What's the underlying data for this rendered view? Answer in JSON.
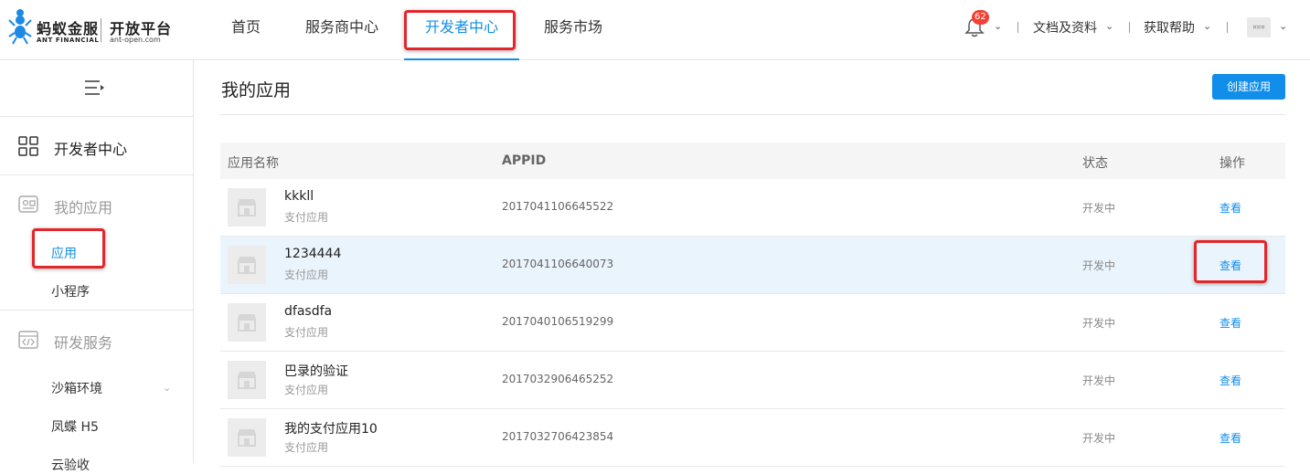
{
  "header": {
    "logo": {
      "brand_cn": "蚂蚁金服",
      "brand_en": "ANT FINANCIAL",
      "platform_cn": "开放平台",
      "platform_en": "ant-open.com"
    },
    "nav": [
      {
        "label": "首页"
      },
      {
        "label": "服务商中心"
      },
      {
        "label": "开发者中心",
        "active": true
      },
      {
        "label": "服务市场"
      }
    ],
    "notification_count": "62",
    "docs_label": "文档及资料",
    "help_label": "获取帮助",
    "avatar_text": "¤¤¤"
  },
  "sidebar": {
    "dev_center": "开发者中心",
    "my_apps": "我的应用",
    "sub_apps": "应用",
    "sub_miniprogram": "小程序",
    "rd_services": "研发服务",
    "sandbox": "沙箱环境",
    "fengdie": "凤蝶 H5",
    "cloud_acceptance": "云验收"
  },
  "main": {
    "title": "我的应用",
    "create_button": "创建应用",
    "columns": {
      "name": "应用名称",
      "appid": "APPID",
      "status": "状态",
      "action": "操作"
    },
    "rows": [
      {
        "name": "kkkll",
        "type": "支付应用",
        "appid": "2017041106645522",
        "status": "开发中",
        "action": "查看"
      },
      {
        "name": "1234444",
        "type": "支付应用",
        "appid": "2017041106640073",
        "status": "开发中",
        "action": "查看"
      },
      {
        "name": "dfasdfa",
        "type": "支付应用",
        "appid": "2017040106519299",
        "status": "开发中",
        "action": "查看"
      },
      {
        "name": "巴录的验证",
        "type": "支付应用",
        "appid": "2017032906465252",
        "status": "开发中",
        "action": "查看"
      },
      {
        "name": "我的支付应用10",
        "type": "支付应用",
        "appid": "2017032706423854",
        "status": "开发中",
        "action": "查看"
      }
    ]
  },
  "colors": {
    "accent": "#108ee9",
    "highlight": "#e4262b",
    "badge": "#f04134",
    "row_hover": "#eaf4fc"
  },
  "icons": [
    "ant-logo-icon",
    "bell-icon",
    "chevron-down-icon",
    "menu-toggle-icon",
    "grid-icon",
    "apps-icon",
    "code-icon",
    "shop-icon"
  ]
}
